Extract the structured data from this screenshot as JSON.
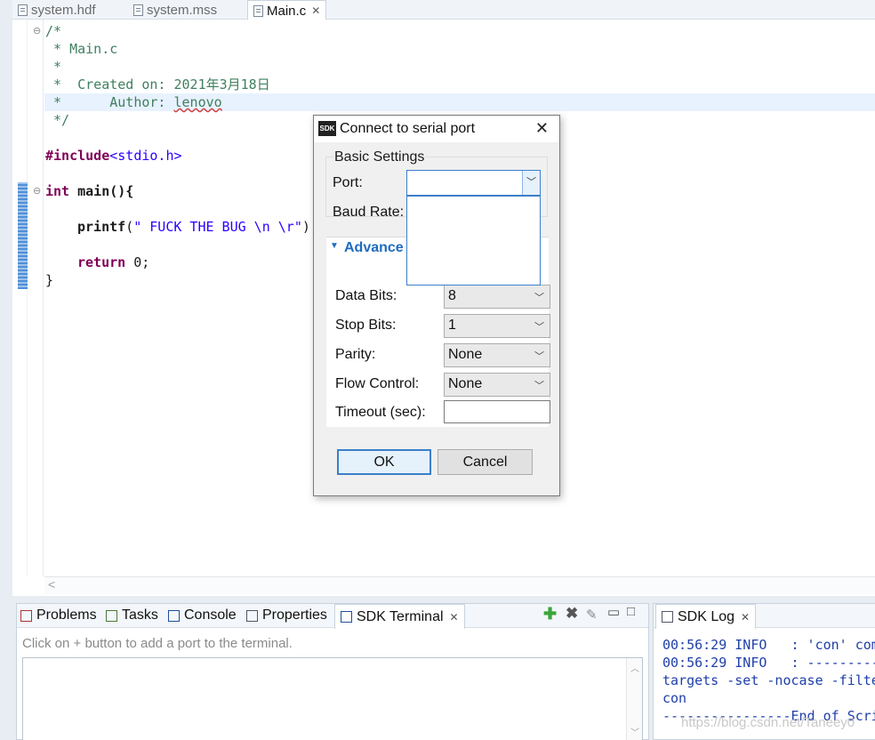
{
  "editor_tabs": [
    {
      "label": "system.hdf",
      "icon": "hdf-file-icon"
    },
    {
      "label": "system.mss",
      "icon": "mss-file-icon"
    },
    {
      "label": "Main.c",
      "icon": "c-file-icon",
      "active": true
    }
  ],
  "code": {
    "l1": "/*",
    "l2": " * Main.c",
    "l3": " *",
    "l4": " *  Created on: 2021年3月18日",
    "l5a": " *      Author: ",
    "l5b": "lenovo",
    "l6": " */",
    "include_kw": "#include",
    "include_hdr": "<stdio.h>",
    "int_kw": "int",
    "main_sig": " main(){",
    "printf_kw": "printf",
    "printf_open": "(",
    "printf_str": "\" FUCK THE BUG \\n \\r\"",
    "printf_close": ");",
    "return_kw": "return",
    "return_val": " 0;",
    "close_brace": "}"
  },
  "dialog": {
    "title": "Connect to serial port",
    "icon_text": "SDK",
    "basic_settings_label": "Basic Settings",
    "port_label": "Port:",
    "port_value": "",
    "baud_label": "Baud Rate:",
    "advanced_label": "Advance",
    "data_bits_label": "Data Bits:",
    "data_bits_value": "8",
    "stop_bits_label": "Stop Bits:",
    "stop_bits_value": "1",
    "parity_label": "Parity:",
    "parity_value": "None",
    "flow_label": "Flow Control:",
    "flow_value": "None",
    "timeout_label": "Timeout (sec):",
    "timeout_value": "",
    "ok_label": "OK",
    "cancel_label": "Cancel"
  },
  "views": {
    "tabs": [
      {
        "label": "Problems",
        "icon": "problems-icon"
      },
      {
        "label": "Tasks",
        "icon": "tasks-icon"
      },
      {
        "label": "Console",
        "icon": "console-icon"
      },
      {
        "label": "Properties",
        "icon": "properties-icon"
      },
      {
        "label": "SDK Terminal",
        "icon": "terminal-icon",
        "active": true
      }
    ],
    "terminal_message": "Click on + button to add a port to the terminal."
  },
  "sdk_log": {
    "tab_label": "SDK Log",
    "lines": [
      "00:56:29 INFO   : 'con' com",
      "00:56:29 INFO   : ---------",
      "targets -set -nocase -filte",
      "con",
      "----------------End of Scri"
    ]
  },
  "watermark": "https://blog.csdn.net/Taneey0"
}
